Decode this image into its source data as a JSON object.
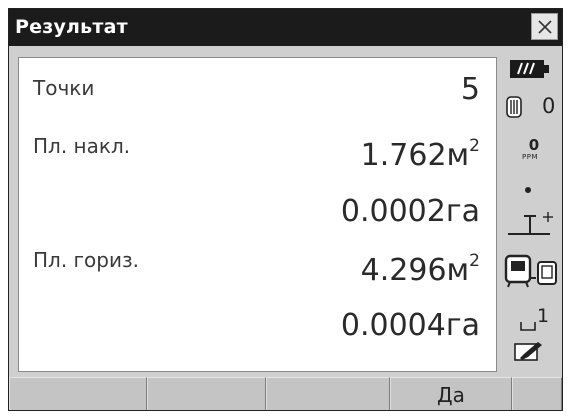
{
  "window": {
    "title": "Результат",
    "close_label": "×"
  },
  "rows": [
    {
      "label": "Точки",
      "value": "5",
      "sup": ""
    },
    {
      "label": "Пл. накл.",
      "value": "1.762м",
      "sup": "2"
    },
    {
      "label": "",
      "value": "0.0002га",
      "sup": ""
    },
    {
      "label": "Пл. гориз.",
      "value": "4.296м",
      "sup": "2"
    },
    {
      "label": "",
      "value": "0.0004га",
      "sup": ""
    }
  ],
  "status": {
    "prism_constant": "0",
    "ppm_value": "0",
    "ppm_label": "PPM",
    "memory_index": "1",
    "battery_level": 1.0
  },
  "softkeys": [
    "",
    "",
    "",
    "Да",
    ""
  ],
  "colors": {
    "title_bg": "#1b1b1b",
    "frame_bg": "#cfcfcf",
    "softkey_bg": "#c4c4c4"
  }
}
